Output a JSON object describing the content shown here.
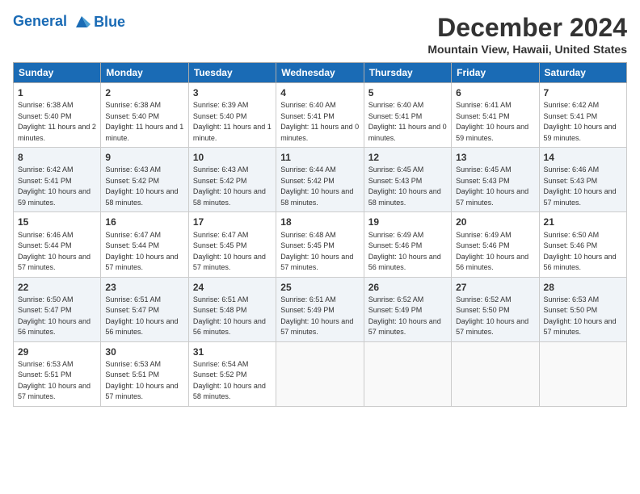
{
  "logo": {
    "line1": "General",
    "line2": "Blue"
  },
  "title": "December 2024",
  "location": "Mountain View, Hawaii, United States",
  "days_of_week": [
    "Sunday",
    "Monday",
    "Tuesday",
    "Wednesday",
    "Thursday",
    "Friday",
    "Saturday"
  ],
  "weeks": [
    [
      {
        "day": "1",
        "sunrise": "6:38 AM",
        "sunset": "5:40 PM",
        "daylight": "11 hours and 2 minutes."
      },
      {
        "day": "2",
        "sunrise": "6:38 AM",
        "sunset": "5:40 PM",
        "daylight": "11 hours and 1 minute."
      },
      {
        "day": "3",
        "sunrise": "6:39 AM",
        "sunset": "5:40 PM",
        "daylight": "11 hours and 1 minute."
      },
      {
        "day": "4",
        "sunrise": "6:40 AM",
        "sunset": "5:41 PM",
        "daylight": "11 hours and 0 minutes."
      },
      {
        "day": "5",
        "sunrise": "6:40 AM",
        "sunset": "5:41 PM",
        "daylight": "11 hours and 0 minutes."
      },
      {
        "day": "6",
        "sunrise": "6:41 AM",
        "sunset": "5:41 PM",
        "daylight": "10 hours and 59 minutes."
      },
      {
        "day": "7",
        "sunrise": "6:42 AM",
        "sunset": "5:41 PM",
        "daylight": "10 hours and 59 minutes."
      }
    ],
    [
      {
        "day": "8",
        "sunrise": "6:42 AM",
        "sunset": "5:41 PM",
        "daylight": "10 hours and 59 minutes."
      },
      {
        "day": "9",
        "sunrise": "6:43 AM",
        "sunset": "5:42 PM",
        "daylight": "10 hours and 58 minutes."
      },
      {
        "day": "10",
        "sunrise": "6:43 AM",
        "sunset": "5:42 PM",
        "daylight": "10 hours and 58 minutes."
      },
      {
        "day": "11",
        "sunrise": "6:44 AM",
        "sunset": "5:42 PM",
        "daylight": "10 hours and 58 minutes."
      },
      {
        "day": "12",
        "sunrise": "6:45 AM",
        "sunset": "5:43 PM",
        "daylight": "10 hours and 58 minutes."
      },
      {
        "day": "13",
        "sunrise": "6:45 AM",
        "sunset": "5:43 PM",
        "daylight": "10 hours and 57 minutes."
      },
      {
        "day": "14",
        "sunrise": "6:46 AM",
        "sunset": "5:43 PM",
        "daylight": "10 hours and 57 minutes."
      }
    ],
    [
      {
        "day": "15",
        "sunrise": "6:46 AM",
        "sunset": "5:44 PM",
        "daylight": "10 hours and 57 minutes."
      },
      {
        "day": "16",
        "sunrise": "6:47 AM",
        "sunset": "5:44 PM",
        "daylight": "10 hours and 57 minutes."
      },
      {
        "day": "17",
        "sunrise": "6:47 AM",
        "sunset": "5:45 PM",
        "daylight": "10 hours and 57 minutes."
      },
      {
        "day": "18",
        "sunrise": "6:48 AM",
        "sunset": "5:45 PM",
        "daylight": "10 hours and 57 minutes."
      },
      {
        "day": "19",
        "sunrise": "6:49 AM",
        "sunset": "5:46 PM",
        "daylight": "10 hours and 56 minutes."
      },
      {
        "day": "20",
        "sunrise": "6:49 AM",
        "sunset": "5:46 PM",
        "daylight": "10 hours and 56 minutes."
      },
      {
        "day": "21",
        "sunrise": "6:50 AM",
        "sunset": "5:46 PM",
        "daylight": "10 hours and 56 minutes."
      }
    ],
    [
      {
        "day": "22",
        "sunrise": "6:50 AM",
        "sunset": "5:47 PM",
        "daylight": "10 hours and 56 minutes."
      },
      {
        "day": "23",
        "sunrise": "6:51 AM",
        "sunset": "5:47 PM",
        "daylight": "10 hours and 56 minutes."
      },
      {
        "day": "24",
        "sunrise": "6:51 AM",
        "sunset": "5:48 PM",
        "daylight": "10 hours and 56 minutes."
      },
      {
        "day": "25",
        "sunrise": "6:51 AM",
        "sunset": "5:49 PM",
        "daylight": "10 hours and 57 minutes."
      },
      {
        "day": "26",
        "sunrise": "6:52 AM",
        "sunset": "5:49 PM",
        "daylight": "10 hours and 57 minutes."
      },
      {
        "day": "27",
        "sunrise": "6:52 AM",
        "sunset": "5:50 PM",
        "daylight": "10 hours and 57 minutes."
      },
      {
        "day": "28",
        "sunrise": "6:53 AM",
        "sunset": "5:50 PM",
        "daylight": "10 hours and 57 minutes."
      }
    ],
    [
      {
        "day": "29",
        "sunrise": "6:53 AM",
        "sunset": "5:51 PM",
        "daylight": "10 hours and 57 minutes."
      },
      {
        "day": "30",
        "sunrise": "6:53 AM",
        "sunset": "5:51 PM",
        "daylight": "10 hours and 57 minutes."
      },
      {
        "day": "31",
        "sunrise": "6:54 AM",
        "sunset": "5:52 PM",
        "daylight": "10 hours and 58 minutes."
      },
      null,
      null,
      null,
      null
    ]
  ]
}
